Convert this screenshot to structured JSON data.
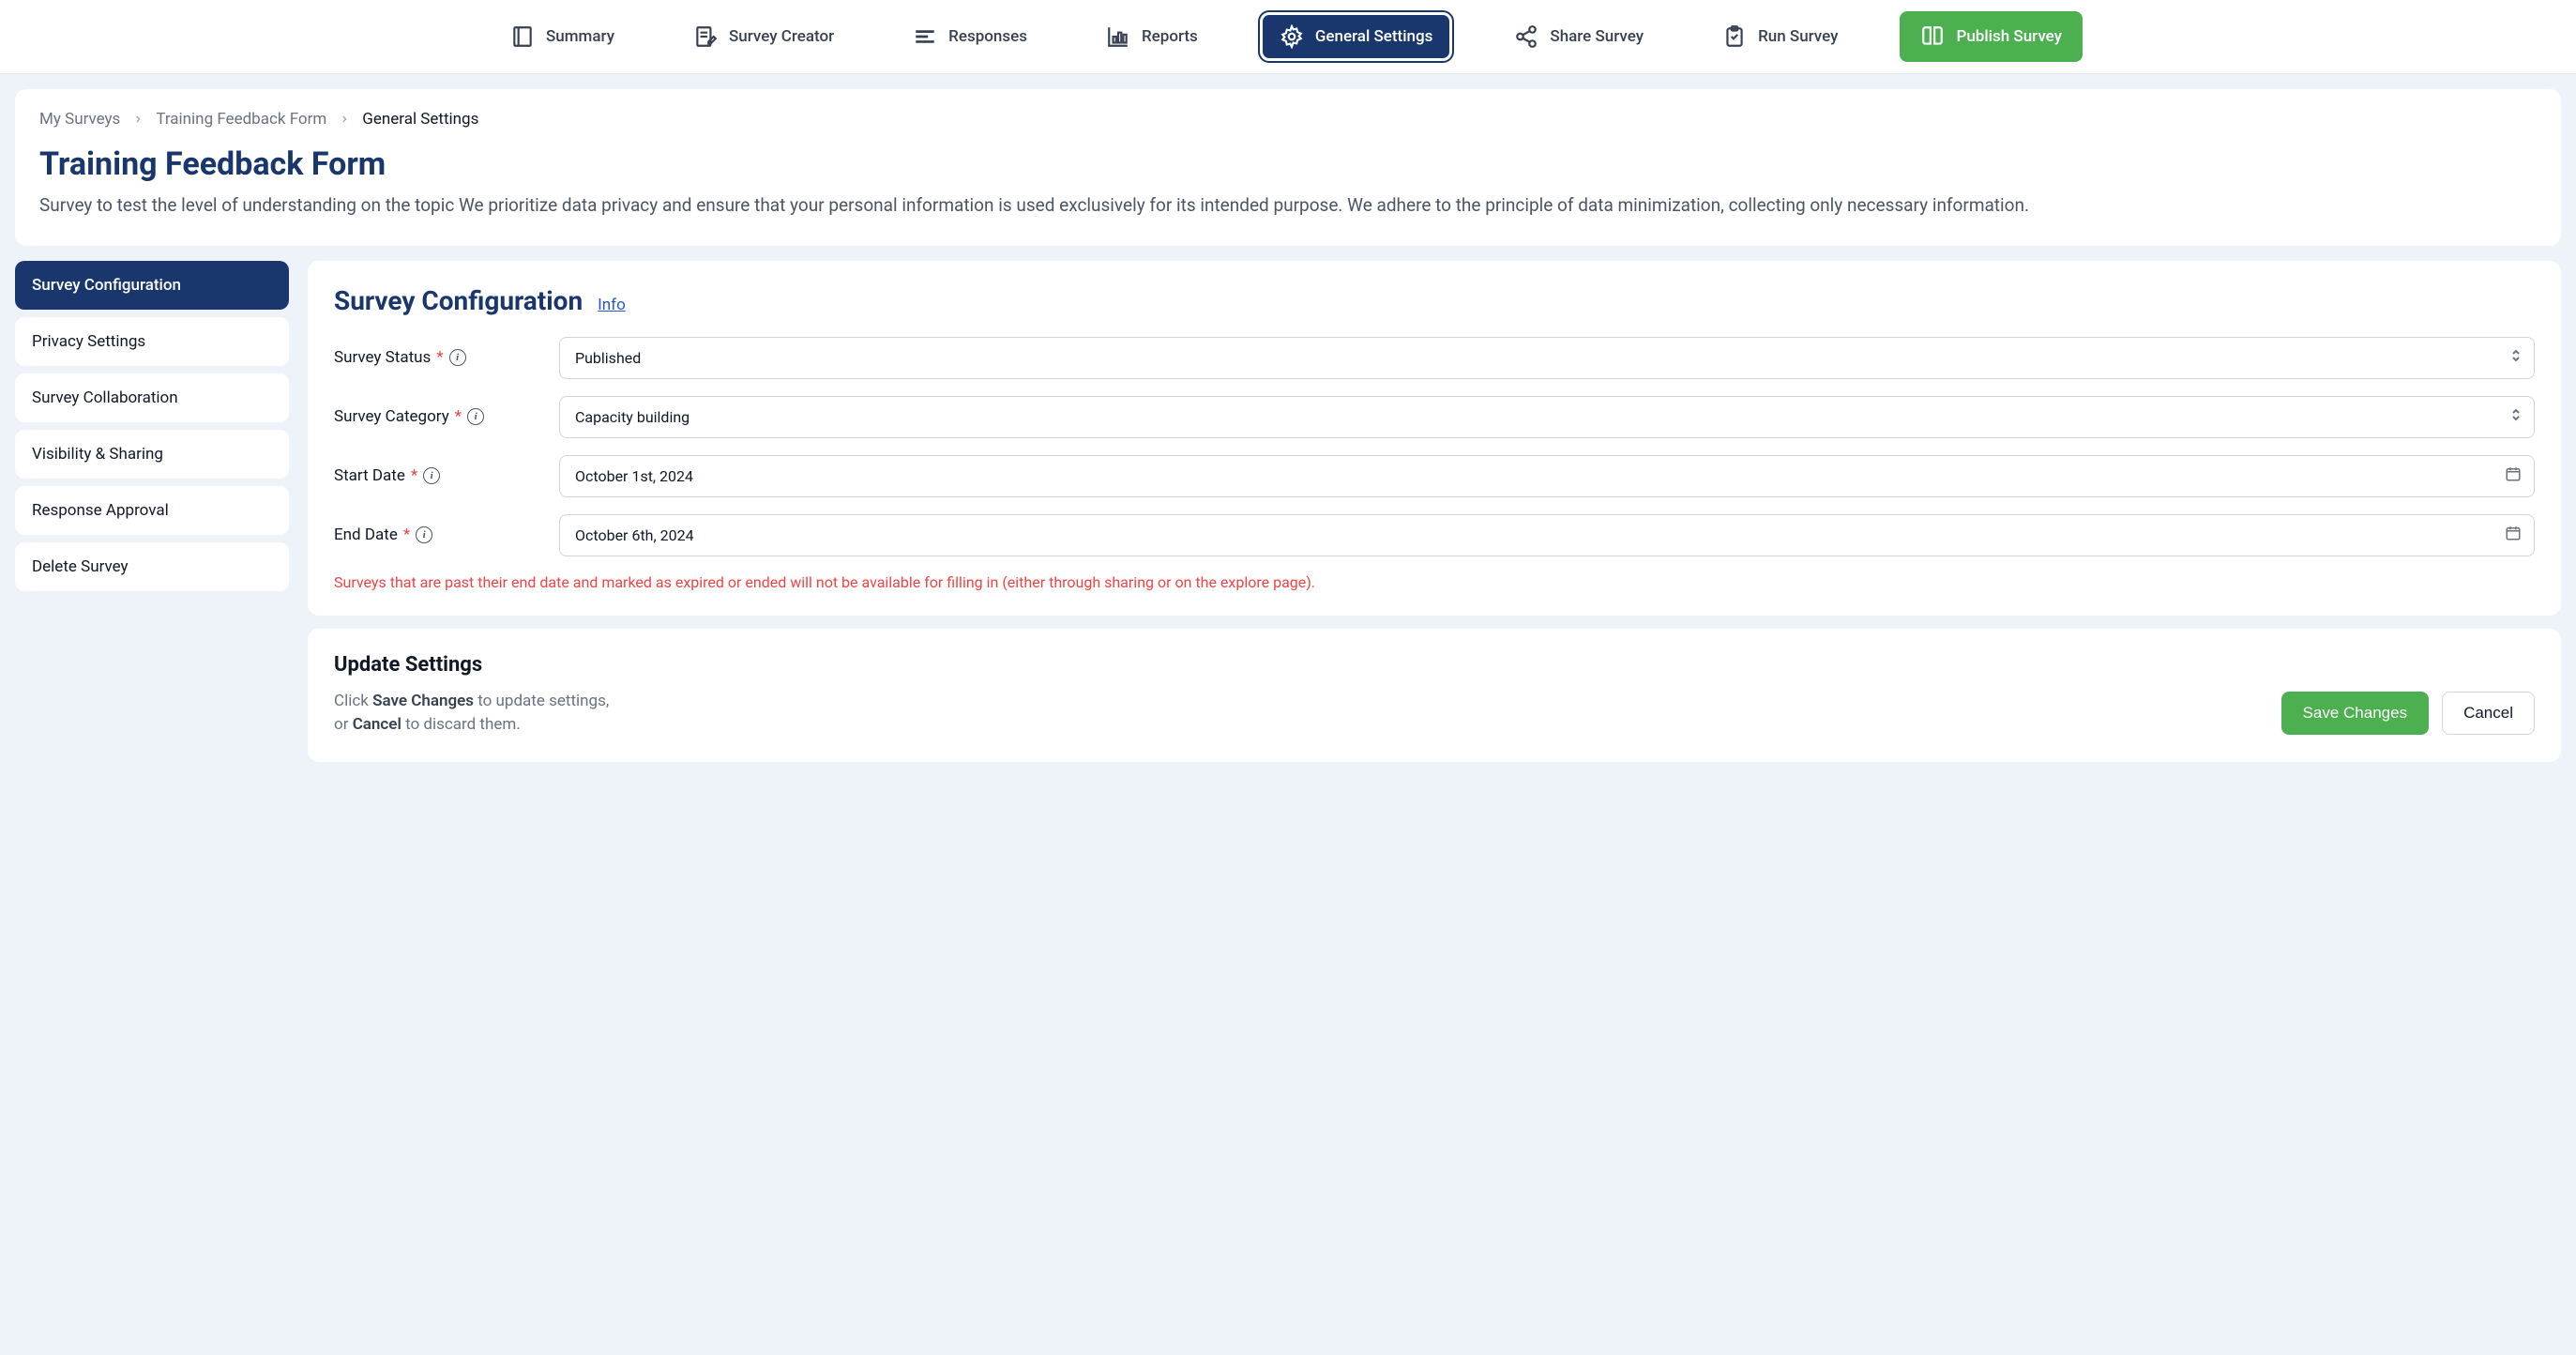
{
  "nav": {
    "summary": "Summary",
    "creator": "Survey Creator",
    "responses": "Responses",
    "reports": "Reports",
    "general": "General Settings",
    "share": "Share Survey",
    "run": "Run Survey",
    "publish": "Publish Survey"
  },
  "breadcrumb": {
    "mySurveys": "My Surveys",
    "surveyName": "Training Feedback Form",
    "current": "General Settings"
  },
  "header": {
    "title": "Training Feedback Form",
    "description": "Survey to test the level of understanding on the topic We prioritize data privacy and ensure that your personal information is used exclusively for its intended purpose. We adhere to the principle of data minimization, collecting only necessary information."
  },
  "sidebar": {
    "items": [
      "Survey Configuration",
      "Privacy Settings",
      "Survey Collaboration",
      "Visibility & Sharing",
      "Response Approval",
      "Delete Survey"
    ]
  },
  "config": {
    "title": "Survey Configuration",
    "infoLabel": "Info",
    "statusLabel": "Survey Status",
    "statusValue": "Published",
    "categoryLabel": "Survey Category",
    "categoryValue": "Capacity building",
    "startDateLabel": "Start Date",
    "startDateValue": "October 1st, 2024",
    "endDateLabel": "End Date",
    "endDateValue": "October 6th, 2024",
    "warning": "Surveys that are past their end date and marked as expired or ended will not be available for filling in (either through sharing or on the explore page)."
  },
  "update": {
    "title": "Update Settings",
    "helpPart1": "Click ",
    "helpBold1": "Save Changes",
    "helpPart2": " to update settings,",
    "helpPart3": "or ",
    "helpBold2": "Cancel",
    "helpPart4": " to discard them.",
    "saveLabel": "Save Changes",
    "cancelLabel": "Cancel"
  }
}
